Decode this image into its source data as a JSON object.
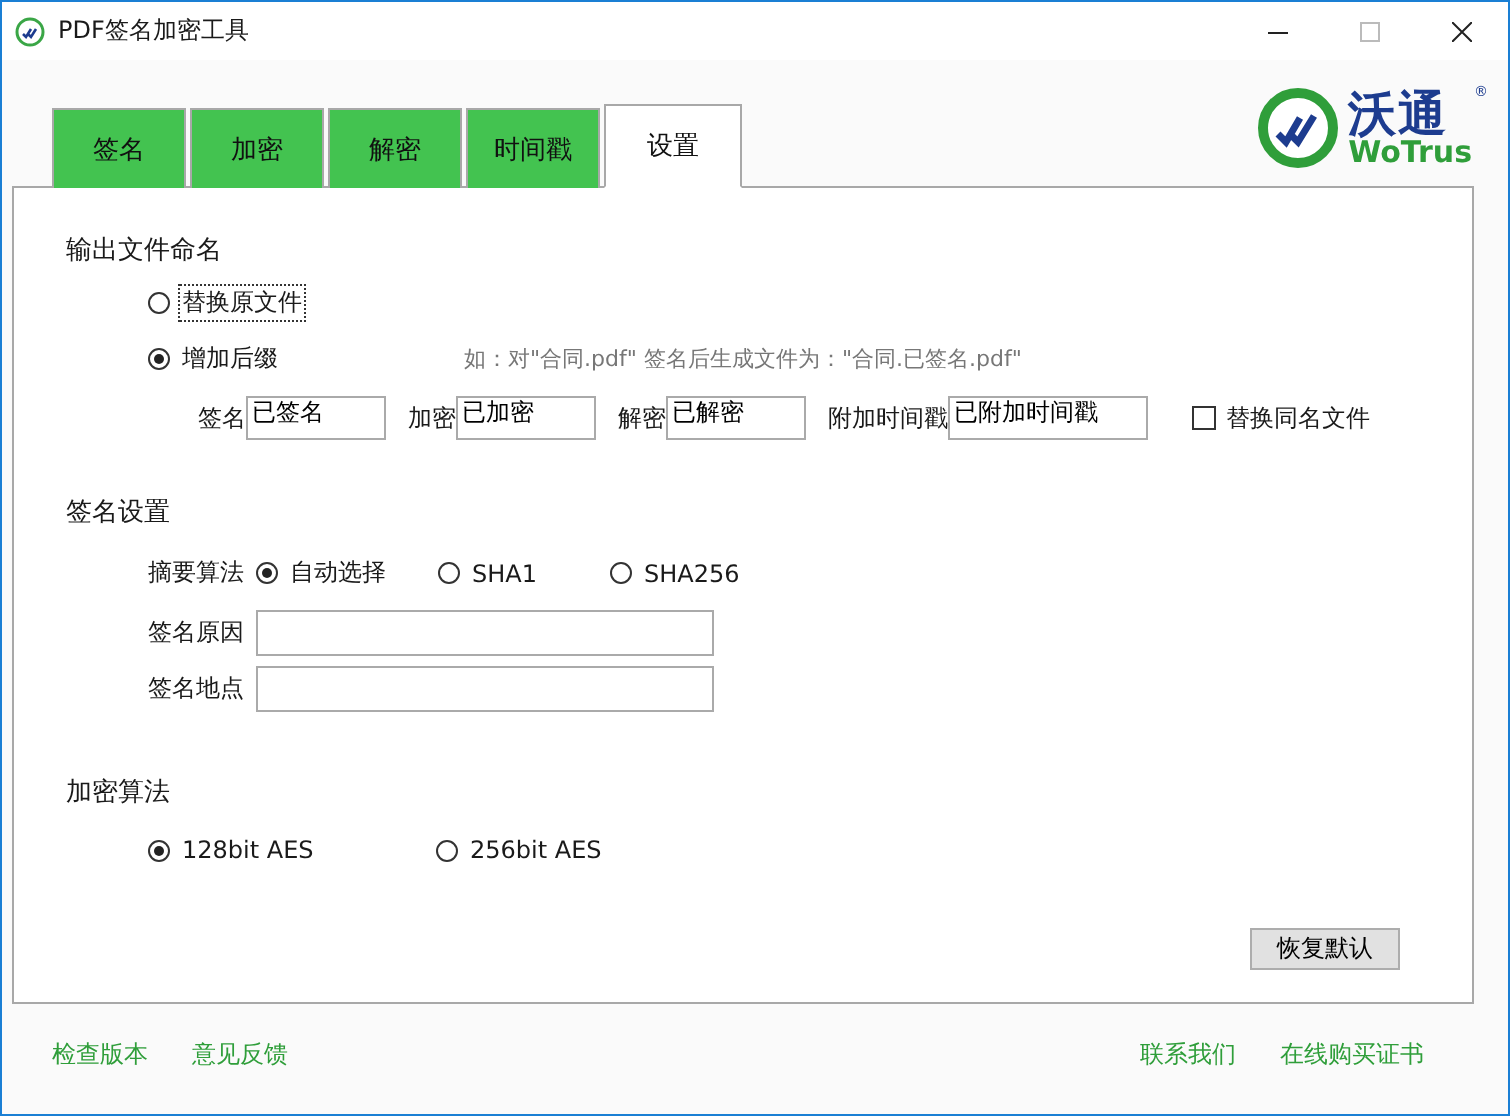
{
  "window": {
    "title": "PDF签名加密工具"
  },
  "logo": {
    "name": "沃通",
    "latin": "WoTrus",
    "mark": "®"
  },
  "tabs": [
    {
      "label": "签名",
      "selected": false
    },
    {
      "label": "加密",
      "selected": false
    },
    {
      "label": "解密",
      "selected": false
    },
    {
      "label": "时间戳",
      "selected": false
    },
    {
      "label": "设置",
      "selected": true
    }
  ],
  "output_naming": {
    "title": "输出文件命名",
    "options": [
      {
        "label": "替换原文件",
        "selected": false,
        "focused": true
      },
      {
        "label": "增加后缀",
        "selected": true,
        "focused": false
      }
    ],
    "hint": "如：对\"合同.pdf\" 签名后生成文件为：\"合同.已签名.pdf\"",
    "suffixes": [
      {
        "label": "签名",
        "value": "已签名"
      },
      {
        "label": "加密",
        "value": "已加密"
      },
      {
        "label": "解密",
        "value": "已解密"
      },
      {
        "label": "附加时间戳",
        "value": "已附加时间戳"
      }
    ],
    "replace_same_name": {
      "label": "替换同名文件",
      "checked": false
    }
  },
  "signature": {
    "title": "签名设置",
    "digest_label": "摘要算法",
    "digest_options": [
      {
        "label": "自动选择",
        "selected": true
      },
      {
        "label": "SHA1",
        "selected": false
      },
      {
        "label": "SHA256",
        "selected": false
      }
    ],
    "fields": [
      {
        "label": "签名原因"
      },
      {
        "label": "签名地点"
      }
    ]
  },
  "encryption": {
    "title": "加密算法",
    "options": [
      {
        "label": "128bit AES",
        "selected": true
      },
      {
        "label": "256bit AES",
        "selected": false
      }
    ]
  },
  "reset_button": "恢复默认",
  "footer_left": [
    "检查版本",
    "意见反馈"
  ],
  "footer_right": [
    "联系我们",
    "在线购买证书"
  ]
}
